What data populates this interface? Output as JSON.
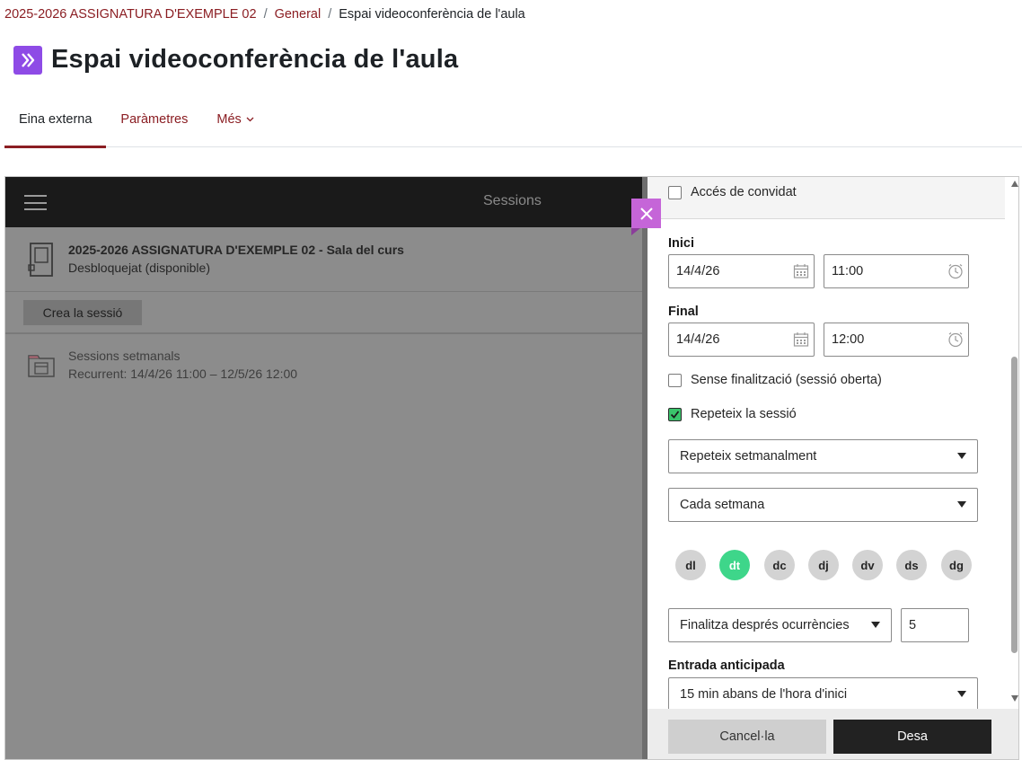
{
  "breadcrumb": {
    "course": "2025-2026 ASSIGNATURA D'EXEMPLE 02",
    "section": "General",
    "current": "Espai videoconferència de l'aula",
    "separator": "/"
  },
  "page": {
    "title": "Espai videoconferència de l'aula",
    "icon": "external-tool-icon",
    "accent_color": "#8e4be6"
  },
  "tabs": [
    {
      "label": "Eina externa",
      "active": true
    },
    {
      "label": "Paràmetres",
      "active": false
    },
    {
      "label": "Més",
      "active": false
    }
  ],
  "app": {
    "header_title": "Sessions",
    "room": {
      "name": "2025-2026 ASSIGNATURA D'EXEMPLE 02 - Sala del curs",
      "status": "Desbloquejat (disponible)"
    },
    "create_button": "Crea la sessió",
    "series": {
      "name": "Sessions setmanals",
      "detail": "Recurrent: 14/4/26 11:00 – 12/5/26 12:00"
    }
  },
  "panel": {
    "guest_access": {
      "label": "Accés de convidat",
      "checked": false
    },
    "start": {
      "label": "Inici",
      "date": "14/4/26",
      "time": "11:00"
    },
    "end": {
      "label": "Final",
      "date": "14/4/26",
      "time": "12:00"
    },
    "no_end": {
      "label": "Sense finalització (sessió oberta)",
      "checked": false
    },
    "repeat": {
      "label": "Repeteix la sessió",
      "checked": true
    },
    "repeat_type": "Repeteix setmanalment",
    "repeat_interval": "Cada setmana",
    "days": [
      {
        "label": "dl",
        "selected": false
      },
      {
        "label": "dt",
        "selected": true
      },
      {
        "label": "dc",
        "selected": false
      },
      {
        "label": "dj",
        "selected": false
      },
      {
        "label": "dv",
        "selected": false
      },
      {
        "label": "ds",
        "selected": false
      },
      {
        "label": "dg",
        "selected": false
      }
    ],
    "end_after": {
      "select": "Finalitza després ocurrències",
      "count": "5"
    },
    "early_entry": {
      "label": "Entrada anticipada",
      "value": "15 min abans de l'hora d'inici"
    }
  },
  "footer": {
    "cancel": "Cancel·la",
    "save": "Desa"
  },
  "colors": {
    "link": "#8b1e23",
    "selected_day": "#3ed68a",
    "checkbox_checked": "#3ac46b",
    "close_button": "#c565d8"
  }
}
